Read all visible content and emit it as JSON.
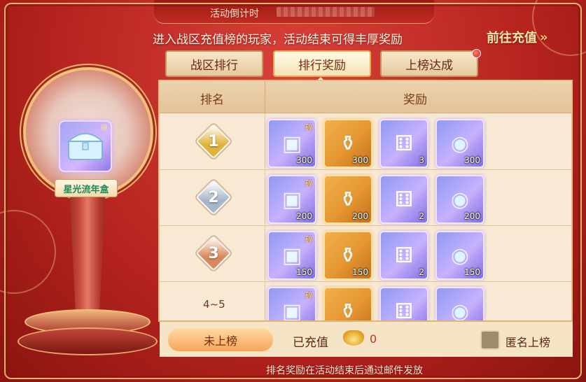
{
  "header": {
    "countdown_label": "活动倒计时",
    "banner": "进入战区充值榜的玩家，活动结束可得丰厚奖励",
    "goto_recharge": "前往充值",
    "goto_chevron": "»"
  },
  "tabs": [
    {
      "label": "战区排行",
      "active": false,
      "has_dot": false
    },
    {
      "label": "排行奖励",
      "active": true,
      "has_dot": false
    },
    {
      "label": "上榜达成",
      "active": false,
      "has_dot": true
    }
  ],
  "showcase": {
    "name": "星光流年盒",
    "icon": "treasure-chest-icon"
  },
  "table": {
    "col_rank": "排名",
    "col_reward": "奖励",
    "rows": [
      {
        "rank": "1",
        "medal_color": "#e0b23a",
        "rewards": [
          {
            "icon": "chest-fragment-icon",
            "count": "300",
            "frag": "碎",
            "kind": "purple"
          },
          {
            "icon": "potion-bottle-icon",
            "count": "300",
            "frag": "",
            "kind": "gold"
          },
          {
            "icon": "dice-box-icon",
            "count": "3",
            "frag": "",
            "kind": "purple"
          },
          {
            "icon": "crystal-orb-icon",
            "count": "300",
            "frag": "",
            "kind": "purple"
          }
        ]
      },
      {
        "rank": "2",
        "medal_color": "#a9b6c8",
        "rewards": [
          {
            "icon": "chest-fragment-icon",
            "count": "200",
            "frag": "碎",
            "kind": "purple"
          },
          {
            "icon": "potion-bottle-icon",
            "count": "200",
            "frag": "",
            "kind": "gold"
          },
          {
            "icon": "dice-box-icon",
            "count": "2",
            "frag": "",
            "kind": "purple"
          },
          {
            "icon": "crystal-orb-icon",
            "count": "200",
            "frag": "",
            "kind": "purple"
          }
        ]
      },
      {
        "rank": "3",
        "medal_color": "#d98a5c",
        "rewards": [
          {
            "icon": "chest-fragment-icon",
            "count": "150",
            "frag": "碎",
            "kind": "purple"
          },
          {
            "icon": "potion-bottle-icon",
            "count": "150",
            "frag": "",
            "kind": "gold"
          },
          {
            "icon": "dice-box-icon",
            "count": "2",
            "frag": "",
            "kind": "purple"
          },
          {
            "icon": "crystal-orb-icon",
            "count": "150",
            "frag": "",
            "kind": "purple"
          }
        ]
      },
      {
        "rank": "4~5",
        "medal_color": "",
        "rewards": [
          {
            "icon": "chest-fragment-icon",
            "count": "",
            "frag": "碎",
            "kind": "purple"
          },
          {
            "icon": "potion-bottle-icon",
            "count": "",
            "frag": "",
            "kind": "gold"
          },
          {
            "icon": "dice-box-icon",
            "count": "",
            "frag": "",
            "kind": "purple"
          },
          {
            "icon": "crystal-orb-icon",
            "count": "",
            "frag": "",
            "kind": "purple"
          }
        ]
      }
    ]
  },
  "footer": {
    "unranked_button": "未上榜",
    "recharged_label": "已充值",
    "recharged_value": "0",
    "anonymous_label": "匿名上榜"
  },
  "bottom_note": "排名奖励在活动结束后通过邮件发放"
}
